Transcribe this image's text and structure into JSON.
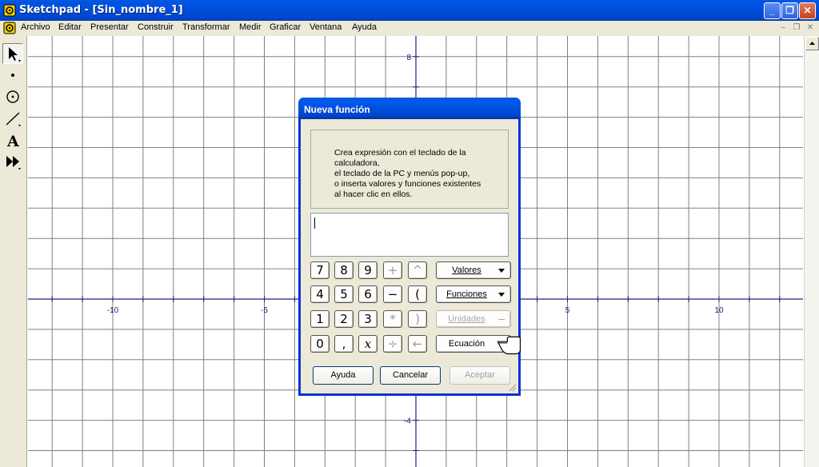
{
  "window": {
    "title": "Sketchpad - [Sin_nombre_1]",
    "buttons": {
      "minimize": "_",
      "restore": "❐",
      "close": "✕"
    }
  },
  "menu": [
    "Archivo",
    "Editar",
    "Presentar",
    "Construir",
    "Transformar",
    "Medir",
    "Graficar",
    "Ventana",
    "Ayuda"
  ],
  "mdi_buttons": {
    "minimize": "–",
    "restore": "❐",
    "close": "✕"
  },
  "toolbox": [
    "arrow-select-icon",
    "point-icon",
    "compass-icon",
    "straightedge-icon",
    "text-tool-icon",
    "custom-tool-icon"
  ],
  "toolbox_text": "A",
  "graph": {
    "x_labels": [
      "-10",
      "-5",
      "5",
      "10"
    ],
    "y_labels": [
      "8",
      "-4"
    ],
    "axis_color": "#1a237e",
    "grid_color": "#808080"
  },
  "dialog": {
    "title": "Nueva función",
    "info": "Crea expresión con el teclado de la calculadora,\nel teclado de la PC y menús pop-up,\no inserta valores y funciones existentes\nal hacer clic en ellos.",
    "expression": "",
    "keys": [
      [
        "7",
        "8",
        "9",
        "+",
        "^"
      ],
      [
        "4",
        "5",
        "6",
        "−",
        "("
      ],
      [
        "1",
        "2",
        "3",
        "*",
        ")"
      ],
      [
        "0",
        ",",
        "x",
        "÷",
        "←"
      ]
    ],
    "menus": {
      "valores": "Valores",
      "funciones": "Funciones",
      "unidades": "Unidades",
      "ecuacion": "Ecuación"
    },
    "buttons": {
      "help": "Ayuda",
      "cancel": "Cancelar",
      "accept": "Aceptar"
    }
  }
}
